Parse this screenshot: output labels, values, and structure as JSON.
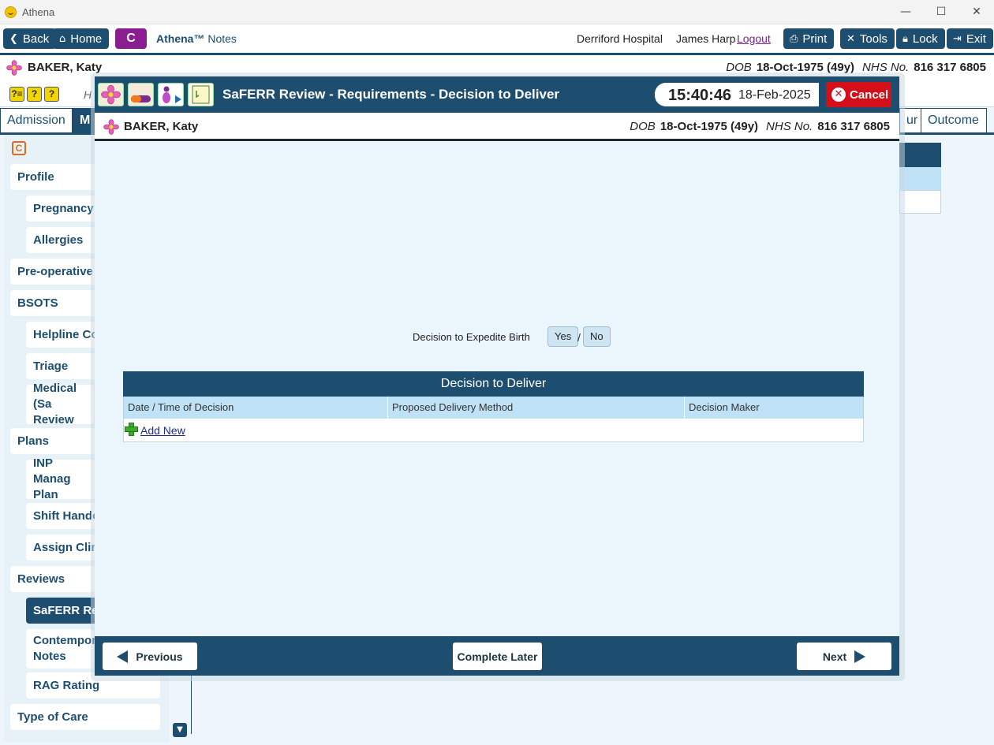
{
  "window": {
    "title": "Athena",
    "minimize": "—",
    "maximize": "☐",
    "close": "✕"
  },
  "toolbar": {
    "back": "Back",
    "home": "Home",
    "c_label": "C",
    "app_name": "Athena™",
    "app_sub": "Notes",
    "hospital": "Derriford Hospital",
    "user": "James Harp",
    "logout": "Logout",
    "print": "Print",
    "tools": "Tools",
    "lock": "Lock",
    "exit": "Exit"
  },
  "patient": {
    "name": "BAKER, Katy",
    "dob_label": "DOB",
    "dob": "18-Oct-1975 (49y)",
    "nhs_label": "NHS No.",
    "nhs": "816 317 6805"
  },
  "background": {
    "help_icons": [
      "?≡",
      "?",
      "?"
    ],
    "header_partial": "H",
    "tabs": [
      {
        "label": "Admission",
        "active": false
      },
      {
        "label": "M",
        "active": true
      },
      {
        "label": "ur",
        "active": false
      },
      {
        "label": "Outcome",
        "active": false
      }
    ],
    "nav": [
      {
        "label": "Profile",
        "level": 0
      },
      {
        "label": "Pregnancy",
        "level": 1
      },
      {
        "label": "Allergies",
        "level": 1
      },
      {
        "label": "Pre-operative",
        "level": 0
      },
      {
        "label": "BSOTS",
        "level": 0
      },
      {
        "label": "Helpline Co",
        "level": 1
      },
      {
        "label": "Triage",
        "level": 1
      },
      {
        "label": "Medical (Sa Review",
        "level": 1
      },
      {
        "label": "Plans",
        "level": 0
      },
      {
        "label": "INP Manag Plan",
        "level": 1
      },
      {
        "label": "Shift Hando",
        "level": 1
      },
      {
        "label": "Assign Clin",
        "level": 1
      },
      {
        "label": "Reviews",
        "level": 0
      },
      {
        "label": "SaFERR Rev",
        "level": 1,
        "active": true
      },
      {
        "label": "Contempor Notes",
        "level": 1
      },
      {
        "label": "RAG Rating",
        "level": 1
      },
      {
        "label": "Type of Care",
        "level": 0
      }
    ]
  },
  "modal": {
    "title": "SaFERR Review - Requirements - Decision to Deliver",
    "time": "15:40:46",
    "date": "18-Feb-2025",
    "cancel": "Cancel",
    "expedite_label": "Decision to Expedite Birth",
    "yes": "Yes",
    "slash": "/",
    "no": "No",
    "table": {
      "title": "Decision to Deliver",
      "columns": [
        "Date / Time of Decision",
        "Proposed Delivery Method",
        "Decision Maker"
      ],
      "add_new": "Add New"
    },
    "footer": {
      "previous": "Previous",
      "complete_later": "Complete Later",
      "next": "Next"
    }
  }
}
